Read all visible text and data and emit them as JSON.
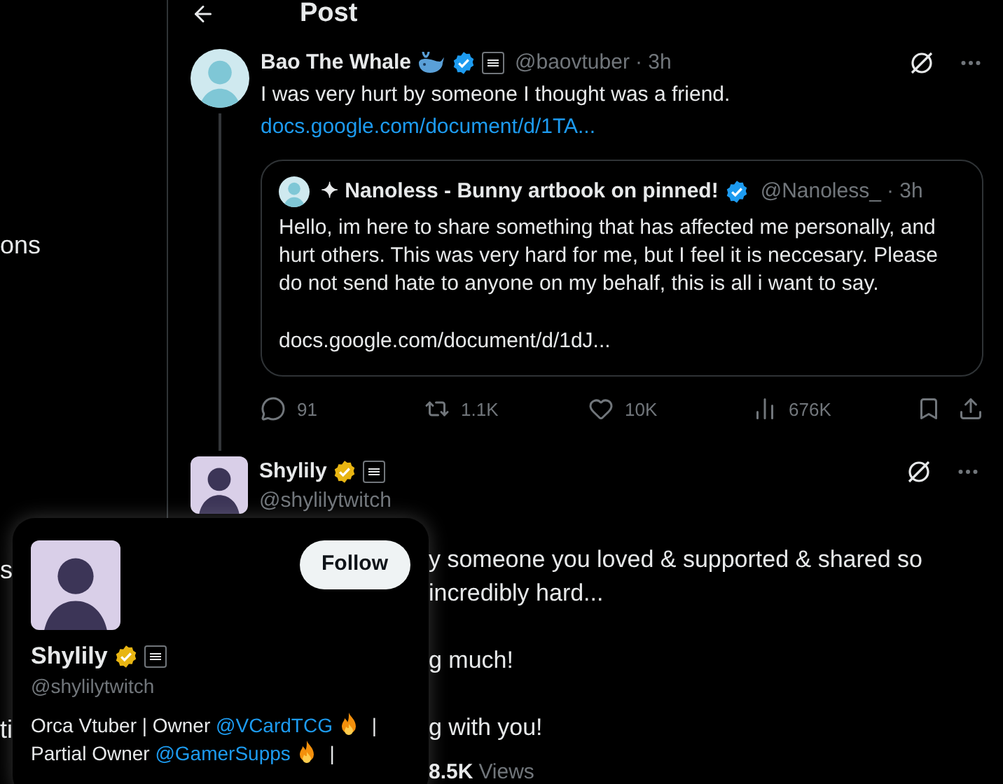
{
  "sidebar": {
    "items": [
      {
        "label": "ons"
      },
      {
        "label": "s"
      },
      {
        "label": "ti"
      }
    ]
  },
  "header": {
    "title": "Post"
  },
  "tweets": [
    {
      "name": "Bao The Whale",
      "verified": {
        "color": "#1d9bf0"
      },
      "whale": true,
      "handle": "@baovtuber",
      "time": "· 3h",
      "text": "I was very hurt by someone I thought was a friend.",
      "link": "docs.google.com/document/d/1TA...",
      "quote": {
        "name": "✦ Nanoless - Bunny artbook on pinned!",
        "verified": {
          "color": "#1d9bf0"
        },
        "handle": "@Nanoless_",
        "time": "· 3h",
        "text": "Hello, im here to share something that has affected me personally, and hurt others. This was very hard for me, but I feel it is neccesary. Please do not send hate to anyone on my behalf, this is all i want to say.",
        "link": "docs.google.com/document/d/1dJ..."
      },
      "stats": [
        {
          "kind": "reply",
          "value": "91"
        },
        {
          "kind": "repost",
          "value": "1.1K"
        },
        {
          "kind": "like",
          "value": "10K"
        },
        {
          "kind": "views",
          "value": "676K"
        }
      ]
    },
    {
      "name": "Shylily",
      "verified": {
        "color": "#e8b512"
      },
      "whale": false,
      "handle": "@shylilytwitch",
      "body": [
        "y someone you loved & supported & shared so",
        "incredibly hard...",
        "g much!",
        "g with you!"
      ],
      "views": {
        "count": "8.5K",
        "label": "Views"
      }
    }
  ],
  "profile_card": {
    "follow_button": "Follow",
    "name": "Shylily",
    "verified": {
      "color": "#e8b512"
    },
    "handle": "@shylilytwitch",
    "bio": [
      [
        {
          "kind": "text",
          "text": "Orca Vtuber | Owner "
        },
        {
          "kind": "mention",
          "text": "@VCardTCG"
        },
        {
          "kind": "flame"
        },
        {
          "kind": "text",
          "text": " |"
        }
      ],
      [
        {
          "kind": "text",
          "text": "Partial Owner "
        },
        {
          "kind": "mention",
          "text": "@GamerSupps"
        },
        {
          "kind": "flame"
        },
        {
          "kind": "text",
          "text": " |"
        }
      ]
    ]
  }
}
